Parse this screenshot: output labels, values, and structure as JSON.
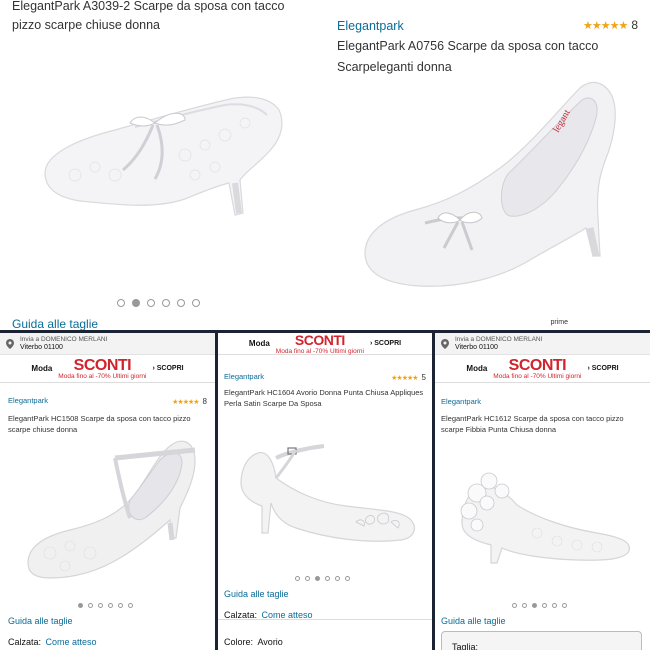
{
  "top_left": {
    "title": "ElegantPark A3039-2 Scarpe da sposa con tacco pizzo scarpe chiuse donna",
    "guide_link": "Guida alle taglie",
    "carousel": {
      "count": 6,
      "active": 1
    }
  },
  "top_right": {
    "brand": "Elegantpark",
    "stars": "★★★★★",
    "rating_count": "8",
    "title": "ElegantPark A0756 Scarpe da sposa con tacco Scarpeleganti donna",
    "prime_badge": "prime"
  },
  "promo": {
    "deliver_to": "Invia a DOMENICO MERLANI",
    "city": "Viterbo 01100",
    "moda": "Moda",
    "sconti": "SCONTI",
    "moda_sub": "Moda fino al -70% Ultimi giorni",
    "scopri": "› SCOPRI"
  },
  "panels": [
    {
      "brand": "Elegantpark",
      "stars": "★★★★★",
      "rating_count": "8",
      "title": "ElegantPark HC1508 Scarpe da sposa con tacco pizzo scarpe chiuse donna",
      "guide_link": "Guida alle taglie",
      "attr_label": "Calzata:",
      "attr_value": "Come atteso"
    },
    {
      "brand": "Elegantpark",
      "stars": "★★★★★",
      "rating_count": "5",
      "title": "ElegantPark HC1604 Avorio Donna Punta Chiusa Appliques Perla Satin Scarpe Da Sposa",
      "guide_link": "Guida alle taglie",
      "attr_label": "Calzata:",
      "attr_value": "Come atteso",
      "color_label": "Colore:",
      "color_value": "Avorio"
    },
    {
      "brand": "Elegantpark",
      "title": "ElegantPark HC1612 Scarpe da sposa con tacco pizzo scarpe Fibbia Punta Chiusa donna",
      "guide_link": "Guida alle taglie",
      "size_label": "Taglia:"
    }
  ]
}
